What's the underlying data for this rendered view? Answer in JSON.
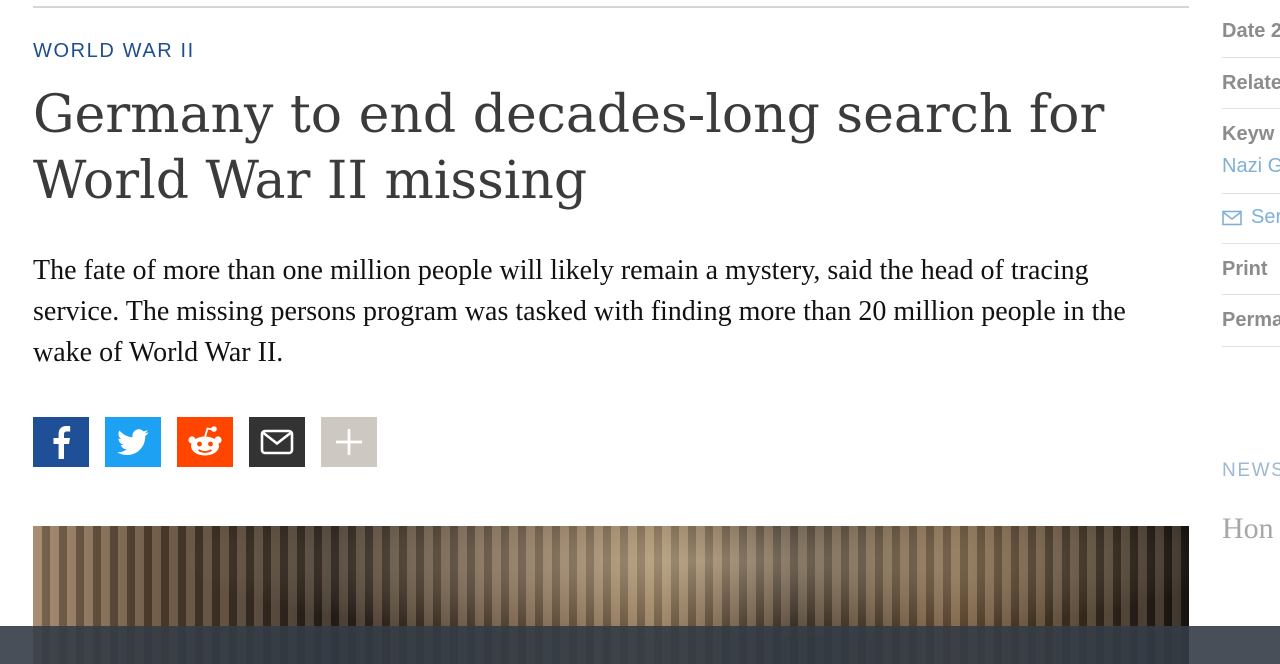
{
  "article": {
    "kicker": "WORLD WAR II",
    "headline": "Germany to end decades-long search for World War II missing",
    "teaser": "The fate of more than one million people will likely remain a mystery, said the head of tracing service. The missing persons program was tasked with finding more than 20 million people in the wake of World War II."
  },
  "share": {
    "buttons": [
      {
        "network": "facebook",
        "icon": "facebook-icon",
        "color": "#1f4f96"
      },
      {
        "network": "twitter",
        "icon": "twitter-icon",
        "color": "#1da1f2"
      },
      {
        "network": "reddit",
        "icon": "reddit-icon",
        "color": "#ff4500"
      },
      {
        "network": "email",
        "icon": "envelope-icon",
        "color": "#333333"
      },
      {
        "network": "more",
        "icon": "plus-icon",
        "color": "#cdc8c2"
      }
    ]
  },
  "sidebar": {
    "date_label": "Date 2",
    "related_label": "Relate",
    "keywords_label": "Keyw",
    "keyword_link": "Nazi G",
    "send_label": "Ser",
    "print_label": "Print",
    "permalink_label": "Perma",
    "news_label": "NEWS",
    "headline_fragment": "Hon with extra"
  },
  "colors": {
    "accent": "#1f4e8c",
    "link": "#7fb0d8"
  }
}
